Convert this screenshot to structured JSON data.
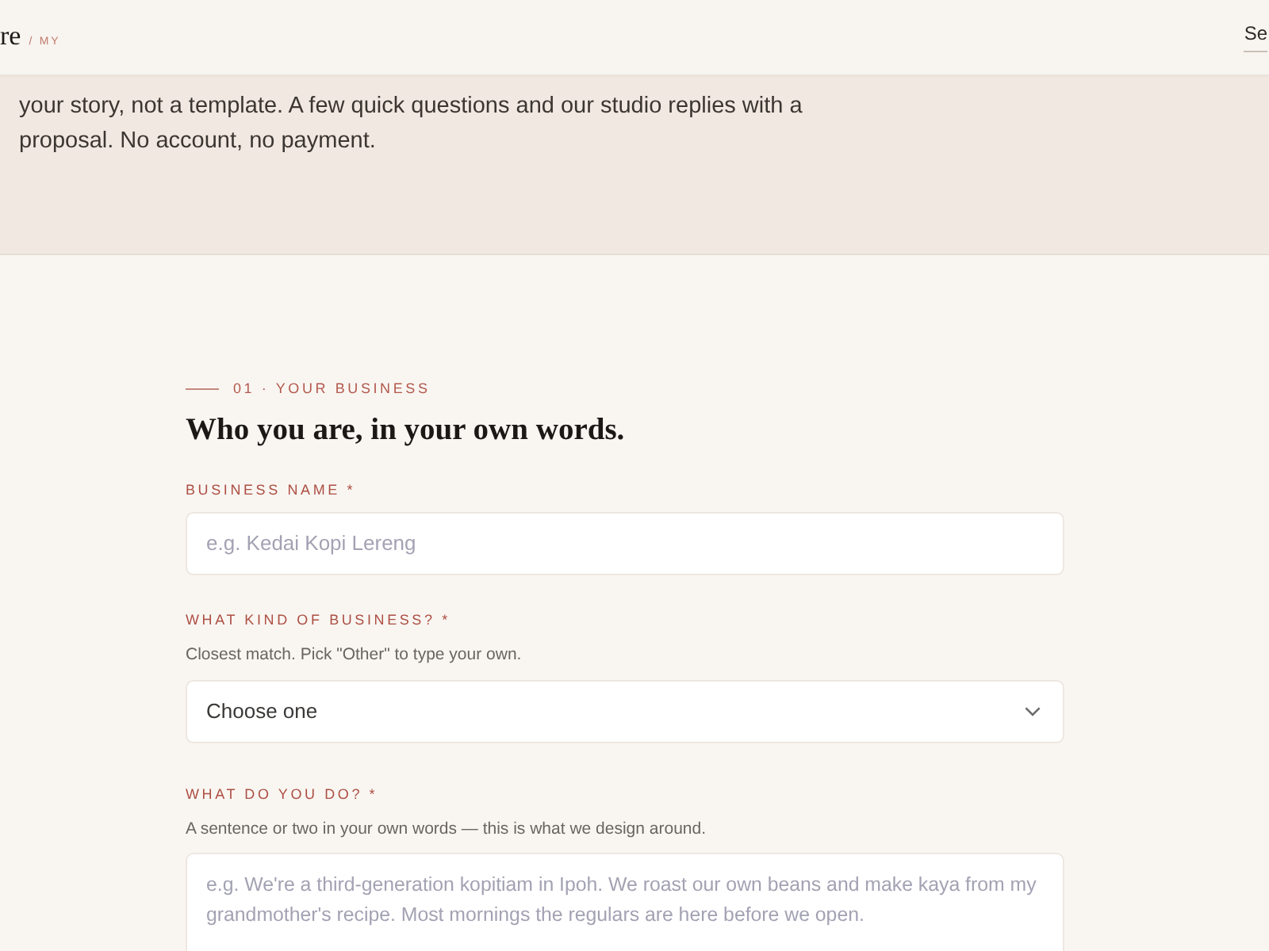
{
  "header": {
    "logo_text": "re",
    "locale": "/ MY",
    "nav_link": "Se"
  },
  "intro": {
    "text": "your story, not a template. A few quick questions and our studio replies with a proposal. No account, no payment."
  },
  "section": {
    "eyebrow": "01 · YOUR BUSINESS",
    "title": "Who you are, in your own words."
  },
  "fields": [
    {
      "kind": "text",
      "label": "BUSINESS NAME *",
      "placeholder": "e.g. Kedai Kopi Lereng"
    },
    {
      "kind": "select",
      "label": "WHAT KIND OF BUSINESS? *",
      "hint": "Closest match. Pick \"Other\" to type your own.",
      "value": "Choose one"
    },
    {
      "kind": "textarea",
      "label": "WHAT DO YOU DO? *",
      "hint": "A sentence or two in your own words — this is what we design around.",
      "placeholder": "e.g. We're a third-generation kopitiam in Ipoh. We roast our own beans and make kaya from my grandmother's recipe. Most mornings the regulars are here before we open."
    }
  ]
}
